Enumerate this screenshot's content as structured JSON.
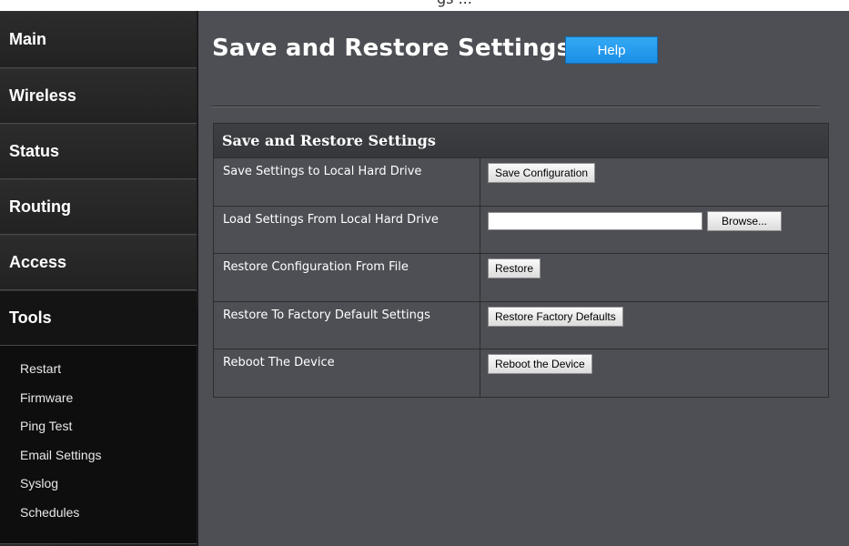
{
  "top_cut_text": "gs ...",
  "sidebar": {
    "items": [
      {
        "label": "Main"
      },
      {
        "label": "Wireless"
      },
      {
        "label": "Status"
      },
      {
        "label": "Routing"
      },
      {
        "label": "Access"
      },
      {
        "label": "Tools"
      }
    ],
    "active": "Tools",
    "submenu": [
      {
        "label": "Restart"
      },
      {
        "label": "Firmware"
      },
      {
        "label": "Ping Test"
      },
      {
        "label": "Email Settings"
      },
      {
        "label": "Syslog"
      },
      {
        "label": "Schedules"
      }
    ]
  },
  "main": {
    "title": "Save and Restore Settings",
    "help_label": "Help",
    "panel": {
      "header": "Save and Restore Settings",
      "rows": [
        {
          "label": "Save Settings to Local Hard Drive",
          "button": "Save Configuration"
        },
        {
          "label": "Load Settings From Local Hard Drive",
          "input_value": "",
          "button": "Browse..."
        },
        {
          "label": "Restore Configuration From File",
          "button": "Restore"
        },
        {
          "label": "Restore To Factory Default Settings",
          "button": "Restore Factory Defaults"
        },
        {
          "label": "Reboot The Device",
          "button": "Reboot the Device"
        }
      ]
    }
  },
  "colors": {
    "sidebar_bg": "#232323",
    "main_bg": "#4d4f54",
    "help_button": "#1b8ee6",
    "panel_header_bg": "#3a3c40"
  }
}
